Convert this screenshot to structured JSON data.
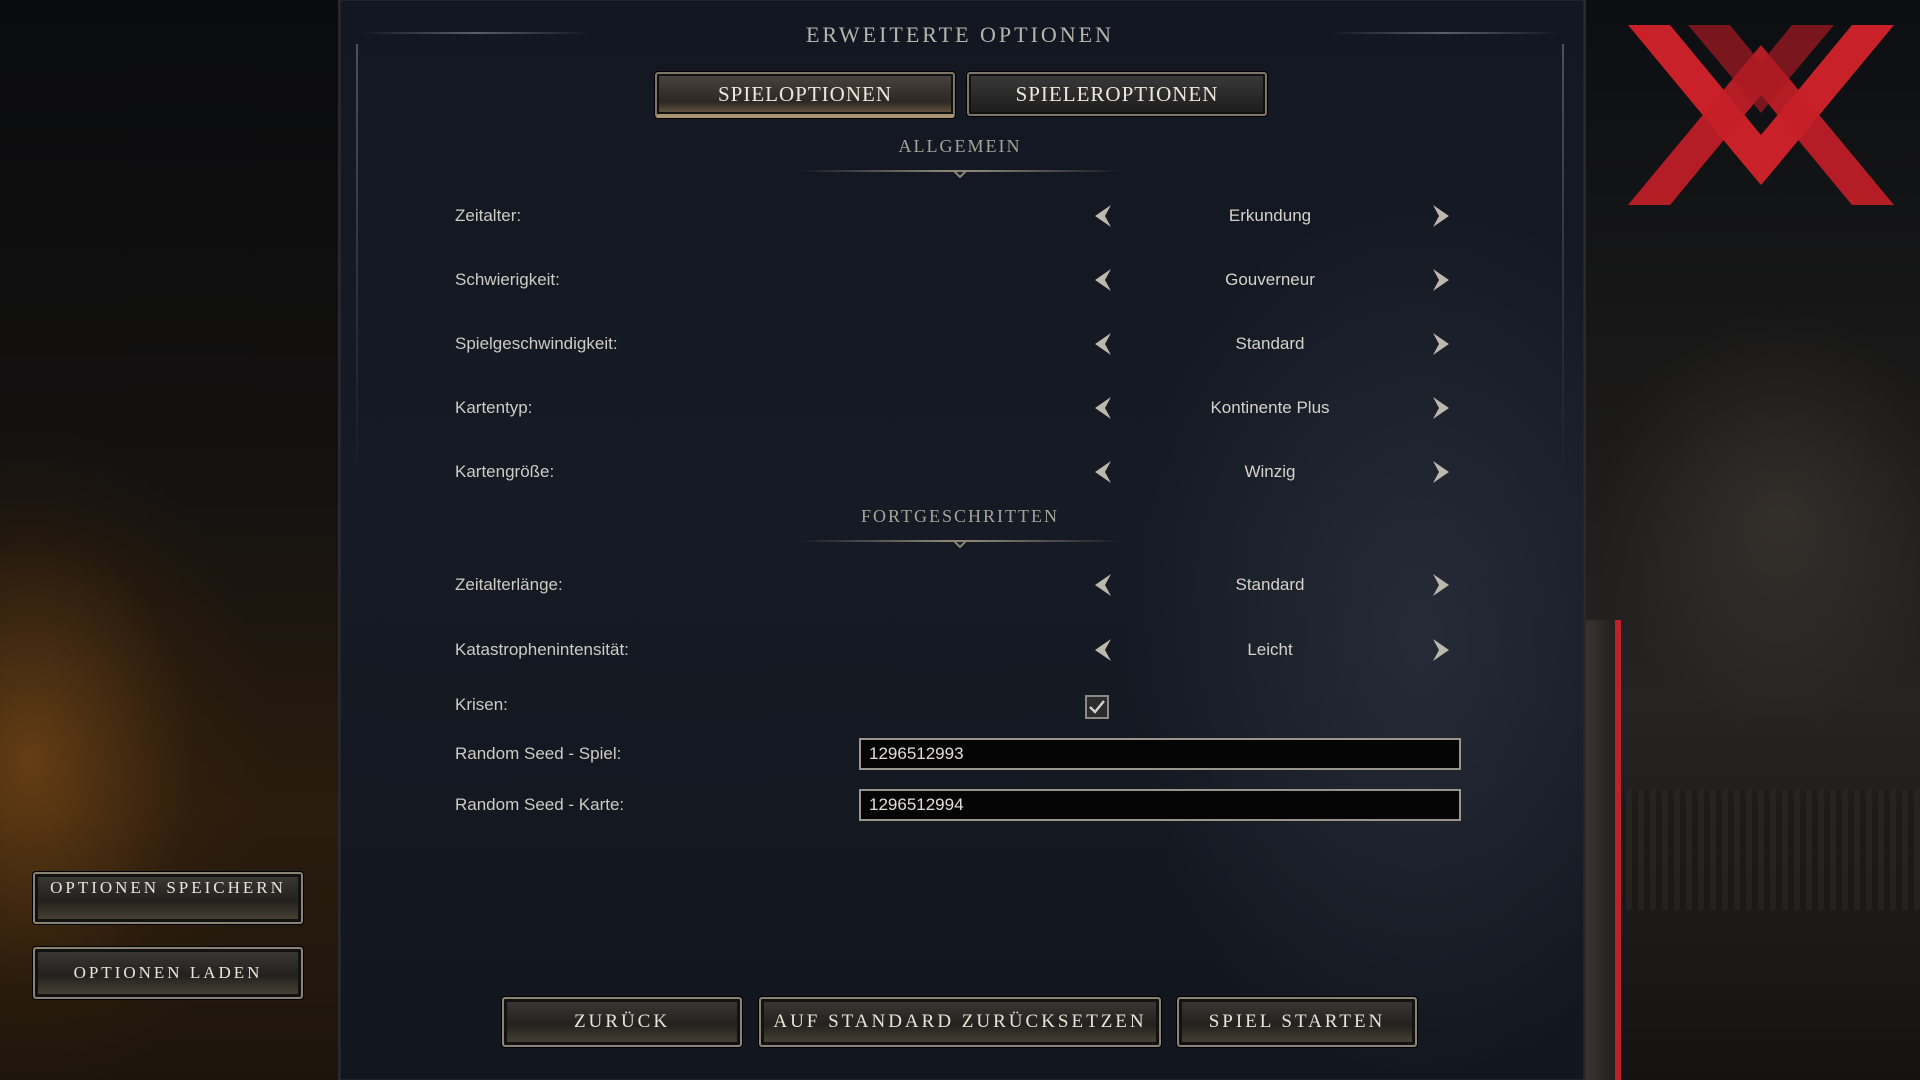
{
  "header": {
    "title": "ERWEITERTE OPTIONEN"
  },
  "tabs": [
    {
      "label": "SPIELOPTIONEN",
      "active": true
    },
    {
      "label": "SPIELEROPTIONEN",
      "active": false
    }
  ],
  "sections": {
    "general": "ALLGEMEIN",
    "advanced": "FORTGESCHRITTEN"
  },
  "options": {
    "zeitalter": {
      "label": "Zeitalter:",
      "value": "Erkundung"
    },
    "schwierigkeit": {
      "label": "Schwierigkeit:",
      "value": "Gouverneur"
    },
    "spielgeschwindigkeit": {
      "label": "Spielgeschwindigkeit:",
      "value": "Standard"
    },
    "kartentyp": {
      "label": "Kartentyp:",
      "value": "Kontinente Plus"
    },
    "kartengroesse": {
      "label": "Kartengröße:",
      "value": "Winzig"
    },
    "zeitalterlaenge": {
      "label": "Zeitalterlänge:",
      "value": "Standard"
    },
    "katastrophen": {
      "label": "Katastrophenintensität:",
      "value": "Leicht"
    }
  },
  "krisen": {
    "label": "Krisen:",
    "checked": true
  },
  "seeds": {
    "spiel": {
      "label": "Random Seed - Spiel:",
      "value": "1296512993"
    },
    "karte": {
      "label": "Random Seed - Karte:",
      "value": "1296512994"
    }
  },
  "sidebar": {
    "save_label": "OPTIONEN SPEICHERN",
    "load_label": "OPTIONEN LADEN"
  },
  "footer": {
    "back_label": "ZURÜCK",
    "reset_label": "AUF STANDARD ZURÜCKSETZEN",
    "start_label": "SPIEL STARTEN"
  },
  "colors": {
    "accent": "#c0202a",
    "panel_bg": "#141923",
    "text": "#cfcbc3",
    "button_border": "#8a8273"
  },
  "icons": [
    "arrow-left-icon",
    "arrow-right-icon",
    "checkmark-icon",
    "logo-icon"
  ]
}
